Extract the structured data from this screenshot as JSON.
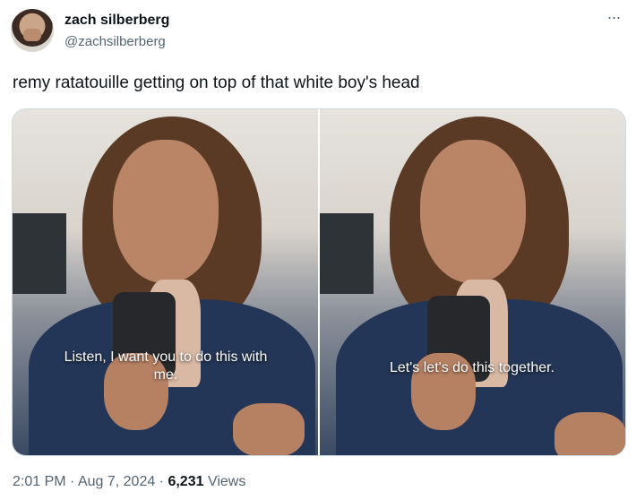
{
  "author": {
    "name": "zach silberberg",
    "handle": "@zachsilberberg",
    "avatar_icon": "user-avatar-icon"
  },
  "more_icon": "more-horizontal-icon",
  "more_glyph": "···",
  "tweet": {
    "text": "remy ratatouille getting on top of that white boy's head"
  },
  "media": {
    "left_caption": "Listen, I want you to do this with me.",
    "right_caption": "Let's let's do this together."
  },
  "meta": {
    "time": "2:01 PM",
    "sep1": " · ",
    "date": "Aug 7, 2024",
    "sep2": " · ",
    "views_count": "6,231",
    "views_label": " Views"
  },
  "colors": {
    "text_primary": "#0f1419",
    "text_secondary": "#536471",
    "border": "#cfd9de"
  }
}
